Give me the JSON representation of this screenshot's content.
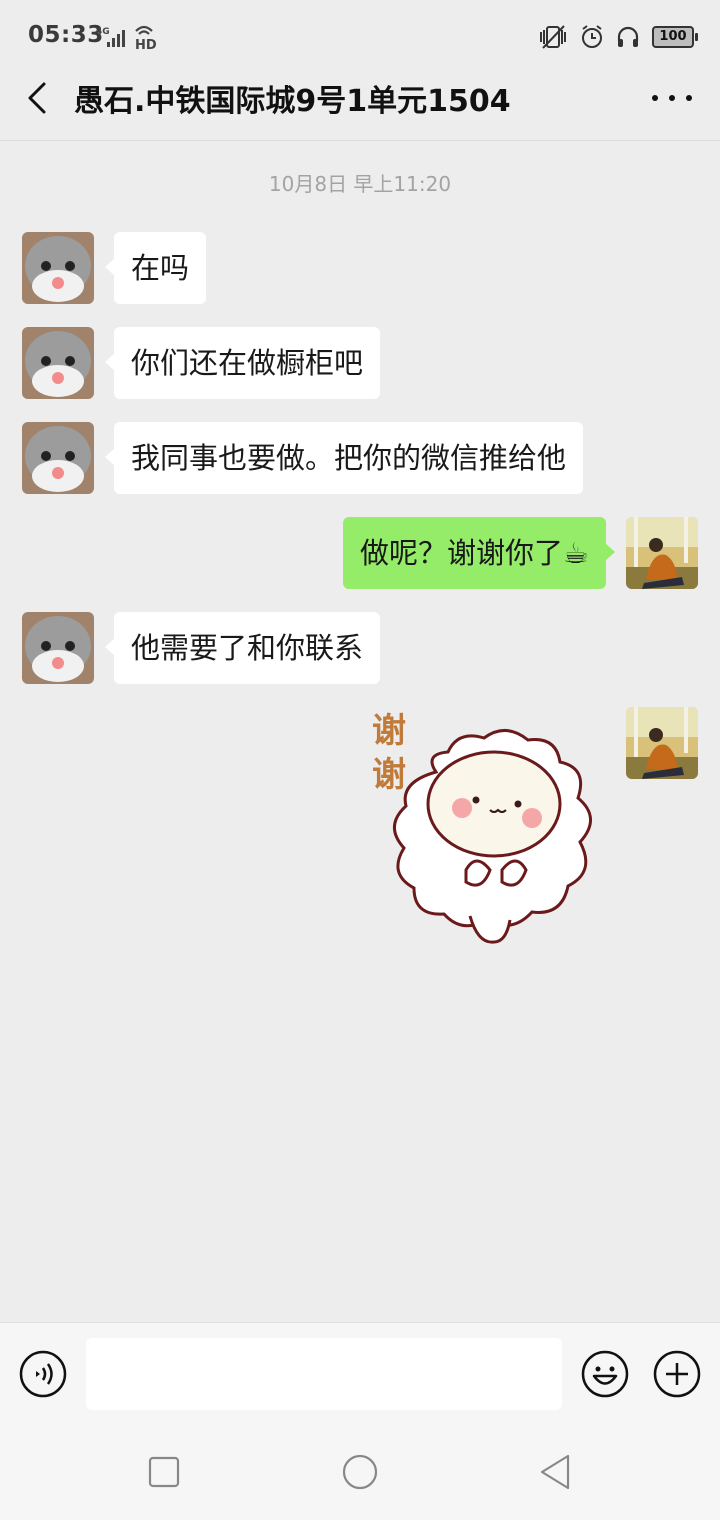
{
  "status_bar": {
    "time": "05:33",
    "network": "4G",
    "hd": "HD",
    "battery": "100"
  },
  "header": {
    "title": "愚石.中铁国际城9号1单元1504"
  },
  "timestamp": "10月8日 早上11:20",
  "messages": [
    {
      "side": "left",
      "text": "在吗"
    },
    {
      "side": "left",
      "text": "你们还在做橱柜吧"
    },
    {
      "side": "left",
      "text": "我同事也要做。把你的微信推给他"
    },
    {
      "side": "right",
      "text": "做呢？谢谢你了☕"
    },
    {
      "side": "left",
      "text": "他需要了和你联系"
    },
    {
      "side": "right",
      "type": "sticker",
      "text": "谢谢"
    }
  ],
  "input": {
    "value": "",
    "placeholder": ""
  },
  "colors": {
    "background": "#ededed",
    "sent_bubble": "#95ec69",
    "received_bubble": "#ffffff"
  },
  "icons": [
    "back-arrow-icon",
    "more-icon",
    "voice-icon",
    "emoji-icon",
    "plus-icon",
    "nav-recent-icon",
    "nav-home-icon",
    "nav-back-icon"
  ]
}
